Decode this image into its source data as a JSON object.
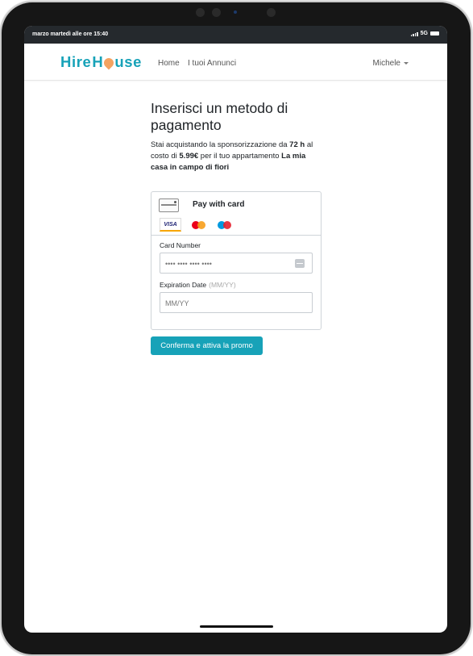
{
  "status_bar": {
    "time": "marzo martedì alle ore 15:40",
    "network": "5G"
  },
  "navbar": {
    "brand_left": "Hire",
    "brand_right": "use",
    "brand_pin_letter": "Ho",
    "links": [
      "Home",
      "I tuoi Annunci"
    ],
    "user": "Michele"
  },
  "page": {
    "title": "Inserisci un metodo di pagamento",
    "desc_1": "Stai acquistando la sponsorizzazione da ",
    "hours": "72 h",
    "desc_2": " al costo di ",
    "price": "5.99€",
    "desc_3": " per il tuo appartamento ",
    "apartment": "La mia casa in campo di fiori"
  },
  "payment": {
    "header": "Pay with card",
    "visa_label": "VISA",
    "card_number_label": "Card Number",
    "card_number_placeholder": "•••• •••• •••• ••••",
    "expiration_label": "Expiration Date",
    "expiration_hint": "(MM/YY)",
    "expiration_placeholder": "MM/YY"
  },
  "actions": {
    "confirm": "Conferma e attiva la promo"
  },
  "colors": {
    "accent": "#17a2b8",
    "pin": "#f4a361"
  },
  "icons": [
    "card-icon",
    "visa-icon",
    "mastercard-icon",
    "maestro-icon",
    "card-number-icon",
    "caret-down-icon",
    "signal-icon",
    "battery-icon"
  ]
}
